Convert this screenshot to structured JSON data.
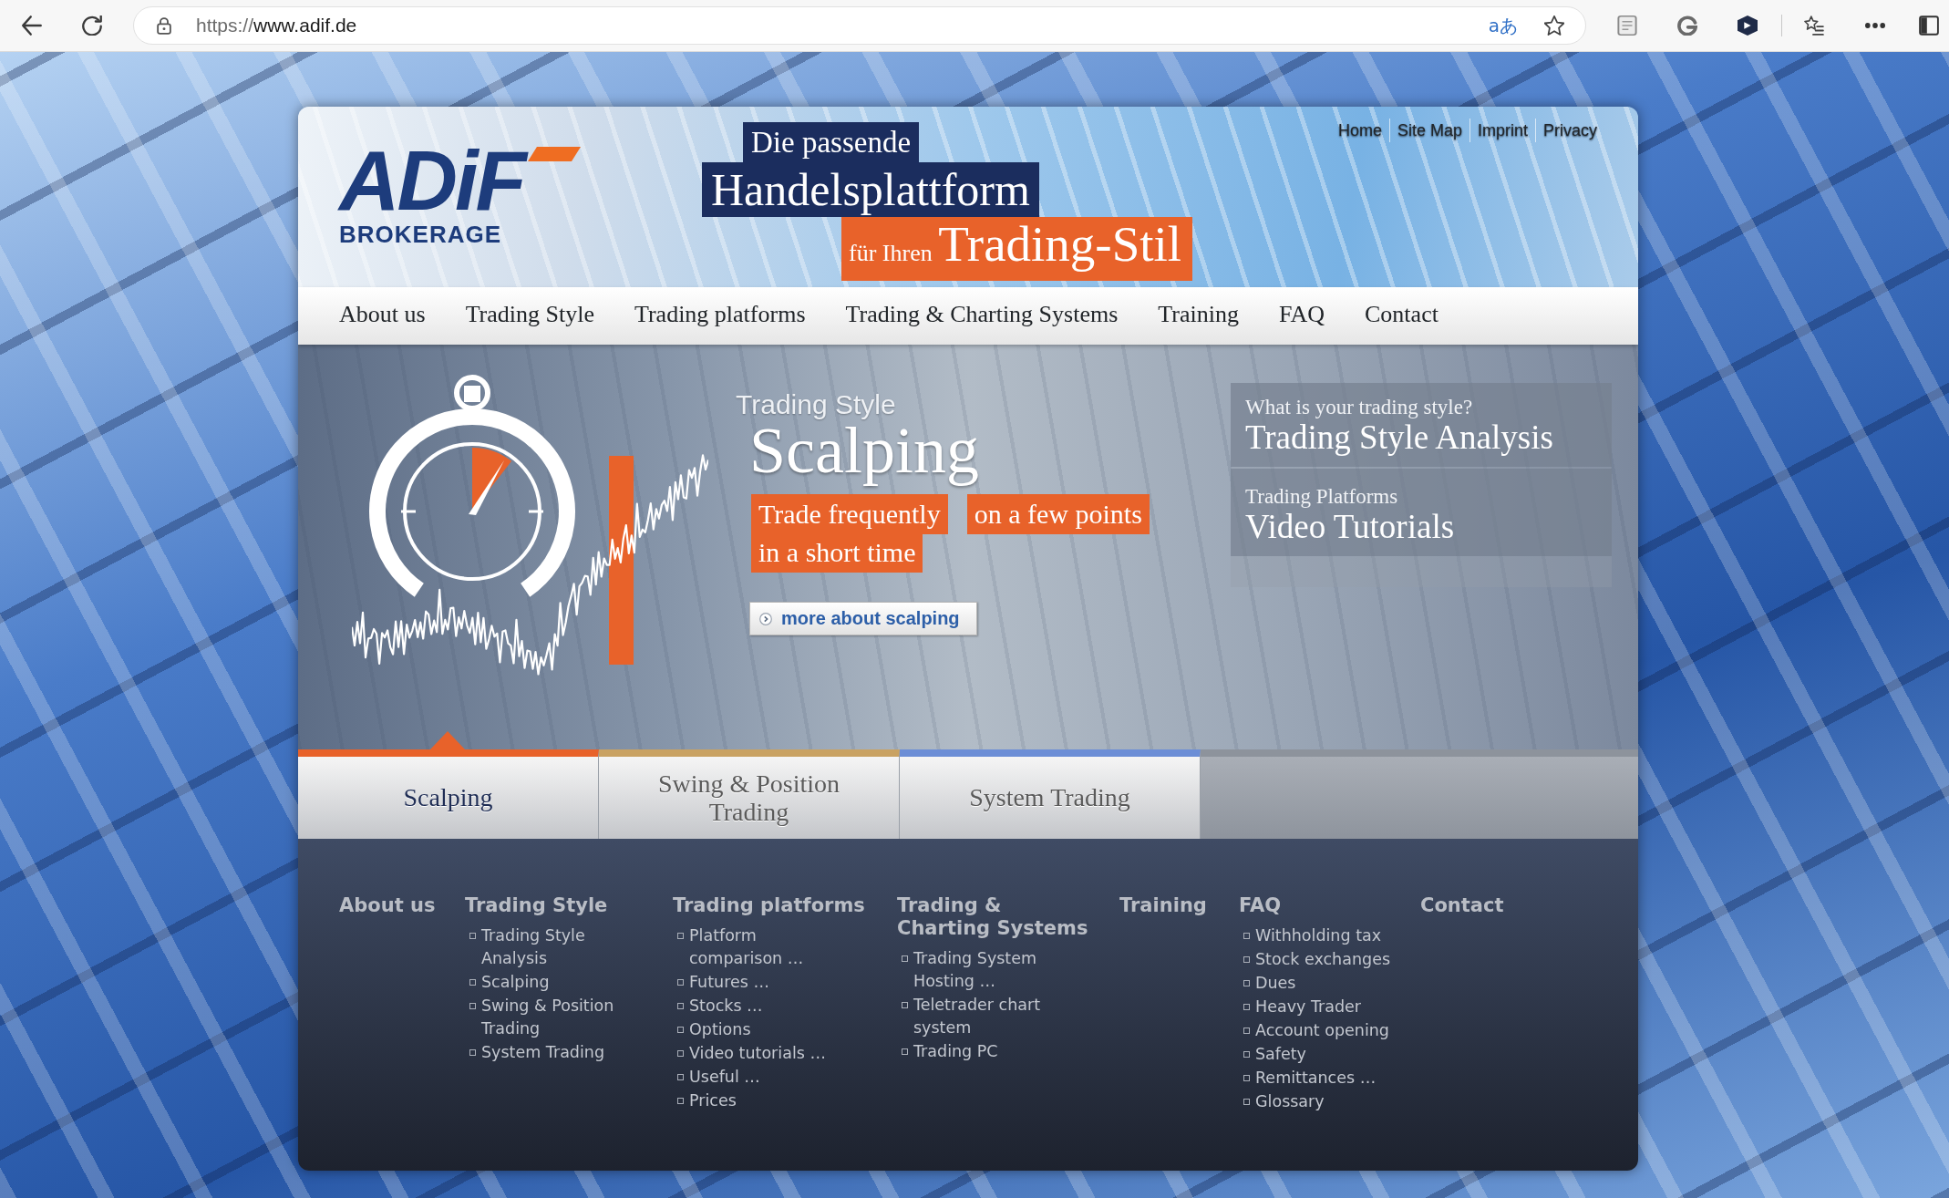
{
  "browser": {
    "url_scheme": "https://",
    "url_host": "www.adif.de",
    "translate_label": "aあ"
  },
  "header": {
    "logo": {
      "wordmark": "ADiF",
      "tagline": "BROKERAGE"
    },
    "headline": [
      {
        "kind": "navy",
        "text": "Die passende"
      },
      {
        "kind": "navy-large",
        "text": "Handelsplattform"
      },
      {
        "kind": "orange",
        "lead": "für Ihren",
        "text": "Trading-Stil"
      }
    ],
    "top_links": [
      "Home",
      "Site Map",
      "Imprint",
      "Privacy"
    ]
  },
  "nav": [
    "About us",
    "Trading Style",
    "Trading platforms",
    "Trading & Charting Systems",
    "Training",
    "FAQ",
    "Contact"
  ],
  "hero": {
    "kicker": "Trading Style",
    "title": "Scalping",
    "highlights": [
      {
        "lines": [
          "Trade frequently",
          "in a short time"
        ]
      },
      {
        "lines": [
          "on a few points"
        ]
      }
    ],
    "button": "more about scalping",
    "promos": [
      {
        "label": "What is your trading style?",
        "title": "Trading Style Analysis"
      },
      {
        "label": "Trading Platforms",
        "title": "Video Tutorials"
      }
    ]
  },
  "tabs": [
    {
      "label": "Scalping",
      "selected": true,
      "color": "#e8622a"
    },
    {
      "label": "Swing & Position Trading",
      "selected": false,
      "color": "#c9a262"
    },
    {
      "label": "System Trading",
      "selected": false,
      "color": "#6c8ed6"
    }
  ],
  "footer": {
    "columns": [
      {
        "heading": "About us"
      },
      {
        "heading": "Trading Style",
        "links": [
          "Trading Style Analysis",
          "Scalping",
          "Swing & Position Trading",
          "System Trading"
        ]
      },
      {
        "heading": "Trading platforms",
        "links": [
          "Platform comparison …",
          "Futures …",
          "Stocks …",
          "Options",
          "Video tutorials …",
          "Useful …",
          "Prices"
        ]
      },
      {
        "heading": "Trading & Charting Systems",
        "links": [
          "Trading System Hosting …",
          "Teletrader chart system",
          "Trading PC"
        ]
      },
      {
        "heading": "Training"
      },
      {
        "heading": "FAQ",
        "links": [
          "Withholding tax",
          "Stock exchanges",
          "Dues",
          "Heavy Trader",
          "Account opening",
          "Safety",
          "Remittances …",
          "Glossary"
        ]
      },
      {
        "heading": "Contact"
      }
    ]
  }
}
